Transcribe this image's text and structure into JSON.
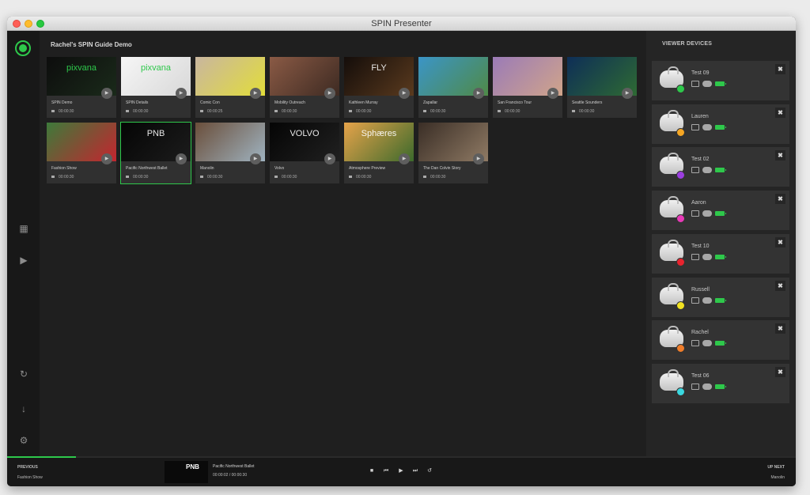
{
  "window": {
    "title": "SPIN Presenter"
  },
  "library": {
    "title": "Rachel's SPIN Guide Demo",
    "cards": [
      {
        "name": "SPIN Demo",
        "duration": "00:00:30",
        "thumb_text": "pixvana",
        "colors": [
          "#0d0d0d",
          "#1a2a1a"
        ]
      },
      {
        "name": "SPIN Details",
        "duration": "00:00:30",
        "thumb_text": "pixvana",
        "colors": [
          "#f6f6f6",
          "#d8d8d8"
        ]
      },
      {
        "name": "Comic Con",
        "duration": "00:00:25",
        "thumb_text": "",
        "colors": [
          "#c9b69f",
          "#e2dd3a"
        ]
      },
      {
        "name": "Mobility Outreach",
        "duration": "00:00:30",
        "thumb_text": "",
        "colors": [
          "#8a5a45",
          "#3d2a22"
        ]
      },
      {
        "name": "Kathleen Murray",
        "duration": "00:00:30",
        "thumb_text": "FLY",
        "colors": [
          "#140d0a",
          "#5a3a1e"
        ]
      },
      {
        "name": "Zapallar",
        "duration": "00:00:30",
        "thumb_text": "",
        "colors": [
          "#3b95c7",
          "#4f8a47"
        ]
      },
      {
        "name": "San Francisco Tour",
        "duration": "00:00:30",
        "thumb_text": "",
        "colors": [
          "#9b7bb7",
          "#d0a48a"
        ]
      },
      {
        "name": "Seattle Sounders",
        "duration": "00:00:30",
        "thumb_text": "",
        "colors": [
          "#0e2e57",
          "#2e6a33"
        ]
      },
      {
        "name": "Fashion Show",
        "duration": "00:00:30",
        "thumb_text": "",
        "colors": [
          "#3d7a3a",
          "#c4252f"
        ]
      },
      {
        "name": "Pacific Northwest Ballet",
        "duration": "00:00:30",
        "thumb_text": "PNB",
        "colors": [
          "#050505",
          "#1c1c1c"
        ]
      },
      {
        "name": "Manolin",
        "duration": "00:00:30",
        "thumb_text": "",
        "colors": [
          "#6a4e3a",
          "#9fb3c0"
        ]
      },
      {
        "name": "Volvo",
        "duration": "00:00:30",
        "thumb_text": "VOLVO",
        "colors": [
          "#050505",
          "#202020"
        ]
      },
      {
        "name": "Atmosphere Preview",
        "duration": "00:00:30",
        "thumb_text": "Sphæres",
        "colors": [
          "#e6a34a",
          "#3c6a2c"
        ]
      },
      {
        "name": "The Dan Colvin Story",
        "duration": "00:00:30",
        "thumb_text": "",
        "colors": [
          "#3a2e26",
          "#8f7a64"
        ]
      }
    ]
  },
  "devices": {
    "title": "VIEWER DEVICES",
    "items": [
      {
        "name": "Test 09",
        "color": "#2ec84b"
      },
      {
        "name": "Lauren",
        "color": "#f5a623"
      },
      {
        "name": "Test 02",
        "color": "#9b3ee0"
      },
      {
        "name": "Aaron",
        "color": "#e83ab8"
      },
      {
        "name": "Test 10",
        "color": "#e8232e"
      },
      {
        "name": "Russell",
        "color": "#f2e221"
      },
      {
        "name": "Rachel",
        "color": "#f07d2a"
      },
      {
        "name": "Test 06",
        "color": "#3ad8e0"
      }
    ],
    "close_glyph": "✖"
  },
  "player": {
    "previous_label": "PREVIOUS",
    "previous_value": "Fashion Show",
    "current_title": "Pacific Northwest Ballet",
    "current_time": "00:00:02  /  00:00:30",
    "thumb_text": "PNB",
    "next_label": "UP NEXT",
    "next_value": "Manolin",
    "progress": 0.087
  }
}
